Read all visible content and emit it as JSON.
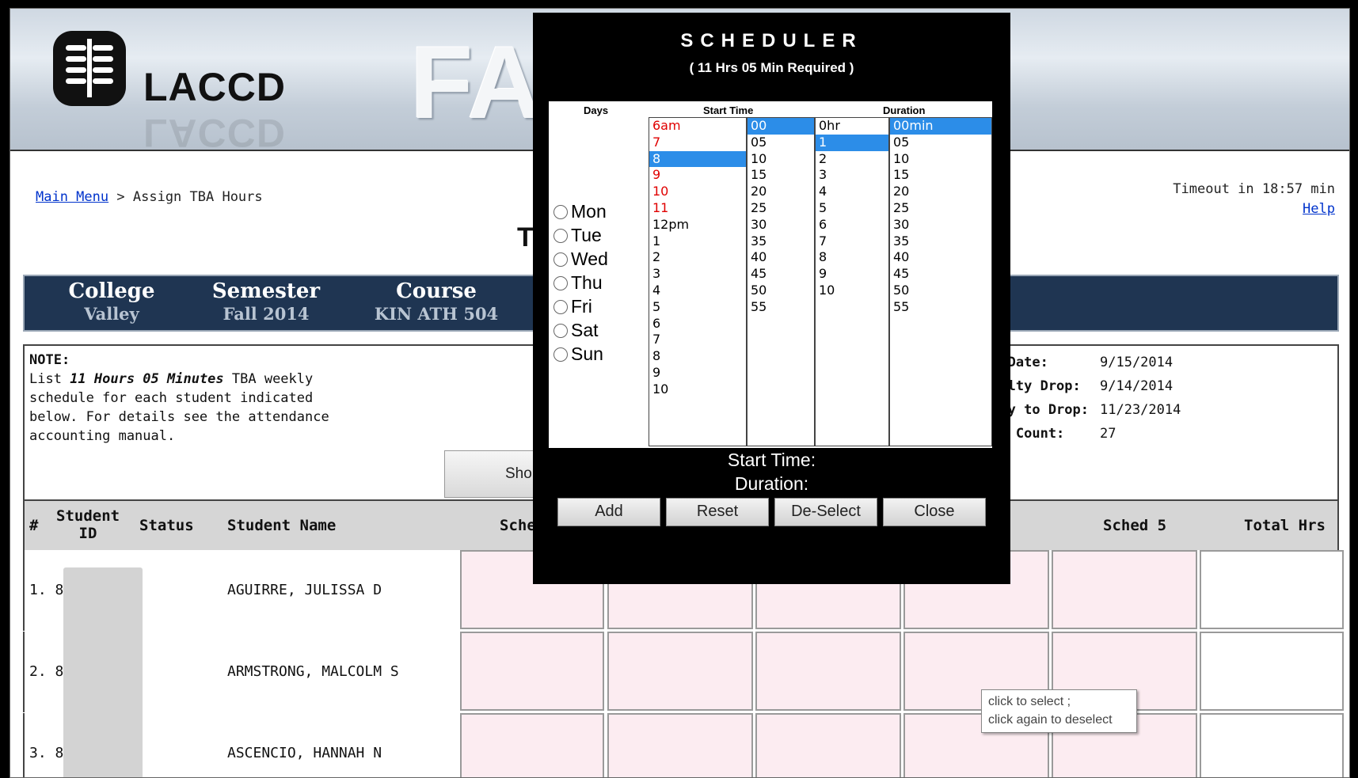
{
  "banner": {
    "logo_text": "LACCD",
    "big_text": "FA"
  },
  "nav": {
    "main_menu": "Main Menu",
    "separator": ">",
    "current": "Assign TBA Hours",
    "timeout": "Timeout in 18:57 min",
    "help": "Help"
  },
  "page_title": "T",
  "info": {
    "college_label": "College",
    "college": "Valley",
    "semester_label": "Semester",
    "semester": "Fall 2014",
    "course_label": "Course",
    "course": "KIN ATH 504"
  },
  "note": {
    "heading": "NOTE:",
    "text_pre": "List ",
    "hours": "11 Hours 05 Minutes",
    "text_post": " TBA weekly schedule for each student indicated below. For details see the attendance accounting manual."
  },
  "dates": {
    "census_label": "Census Date:",
    "census": "9/15/2014",
    "nopenalty_label": "No Penalty Drop:",
    "nopenalty": "9/14/2014",
    "lastday_label": "Last Day to Drop:",
    "lastday": "11/23/2014",
    "count_label": "Student Count:",
    "count": "27"
  },
  "show_button": "Sho",
  "table": {
    "headers": {
      "num": "#",
      "student_id": "Student ID",
      "status": "Status",
      "name": "Student Name",
      "sched1": "Sche",
      "sched5": "Sched 5",
      "total": "Total Hrs"
    },
    "rows": [
      {
        "num": "1. 8",
        "name": "AGUIRRE, JULISSA D"
      },
      {
        "num": "2. 8",
        "name": "ARMSTRONG, MALCOLM S"
      },
      {
        "num": "3. 8",
        "name": "ASCENCIO, HANNAH N"
      }
    ]
  },
  "tooltip": {
    "line1": "click to select ;",
    "line2": "click again to deselect"
  },
  "scheduler": {
    "title": "SCHEDULER",
    "subtitle": "( 11 Hrs 05 Min Required )",
    "days_label": "Days",
    "start_label": "Start Time",
    "duration_label": "Duration",
    "days": [
      "Mon",
      "Tue",
      "Wed",
      "Thu",
      "Fri",
      "Sat",
      "Sun"
    ],
    "hours": [
      "6am",
      "7",
      "8",
      "9",
      "10",
      "11",
      "12pm",
      "1",
      "2",
      "3",
      "4",
      "5",
      "6",
      "7",
      "8",
      "9",
      "10"
    ],
    "hours_red": [
      0,
      1,
      3,
      4,
      5
    ],
    "hours_selected": 2,
    "minutes": [
      "00",
      "05",
      "10",
      "15",
      "20",
      "25",
      "30",
      "35",
      "40",
      "45",
      "50",
      "55"
    ],
    "minutes_selected": 0,
    "dur_hours": [
      "0hr",
      "1",
      "2",
      "3",
      "4",
      "5",
      "6",
      "7",
      "8",
      "9",
      "10"
    ],
    "dur_hours_selected": 1,
    "dur_mins": [
      "00min",
      "05",
      "10",
      "15",
      "20",
      "25",
      "30",
      "35",
      "40",
      "45",
      "50",
      "55"
    ],
    "dur_mins_selected": 0,
    "start_time_label": "Start Time:",
    "duration_text_label": "Duration:",
    "buttons": {
      "add": "Add",
      "reset": "Reset",
      "deselect": "De-Select",
      "close": "Close"
    },
    "selected_color": "#2c8de8",
    "red_color": "#e00000"
  }
}
